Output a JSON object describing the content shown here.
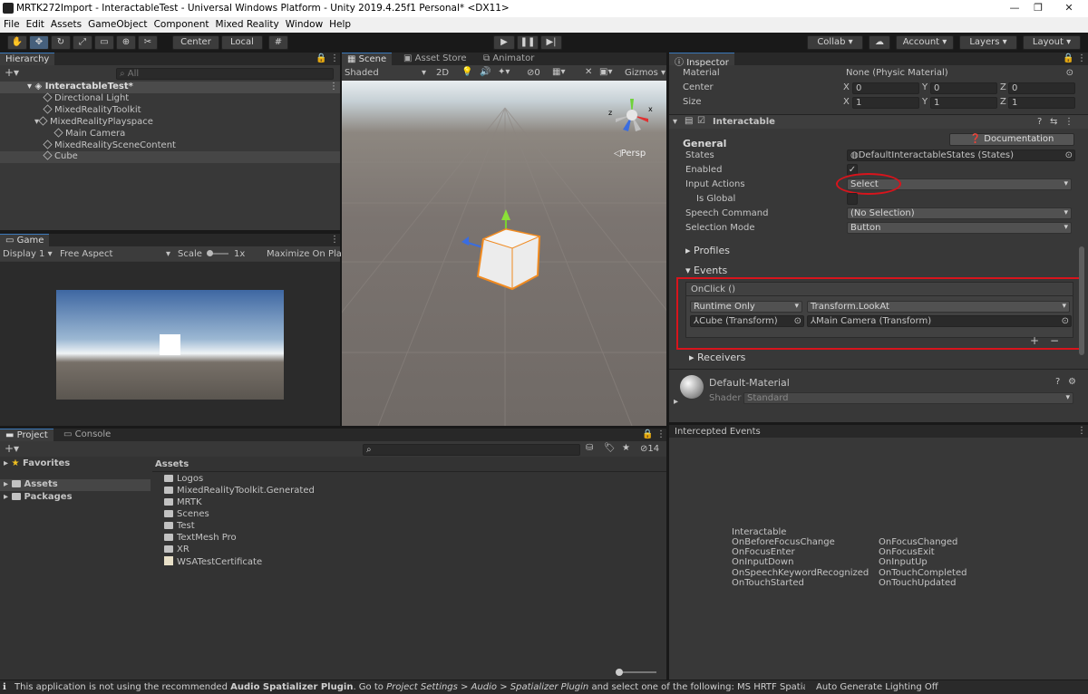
{
  "window": {
    "title": "MRTK272Import - InteractableTest - Universal Windows Platform - Unity 2019.4.25f1 Personal* <DX11>"
  },
  "menu": [
    "File",
    "Edit",
    "Assets",
    "GameObject",
    "Component",
    "Mixed Reality",
    "Window",
    "Help"
  ],
  "toolbar": {
    "center": "Center",
    "local": "Local",
    "collab": "Collab",
    "account": "Account",
    "layers": "Layers",
    "layout": "Layout"
  },
  "hierarchy": {
    "tab": "Hierarchy",
    "search_placeholder": "All",
    "scene": "InteractableTest*",
    "items": [
      {
        "label": "Directional Light"
      },
      {
        "label": "MixedRealityToolkit"
      },
      {
        "label": "MixedRealityPlayspace"
      },
      {
        "label": "Main Camera"
      },
      {
        "label": "MixedRealitySceneContent"
      },
      {
        "label": "Cube"
      }
    ]
  },
  "scene_view": {
    "tabs": [
      "Scene",
      "Asset Store",
      "Animator"
    ],
    "shading": "Shaded",
    "mode_2d": "2D",
    "hidden_count": "0",
    "gizmos": "Gizmos",
    "persp": "Persp"
  },
  "game_view": {
    "tab": "Game",
    "display": "Display 1",
    "aspect": "Free Aspect",
    "scale_label": "Scale",
    "scale_value": "1x",
    "maximize": "Maximize On Play"
  },
  "inspector": {
    "tab": "Inspector",
    "collider": {
      "material_label": "Material",
      "material_value": "None (Physic Material)",
      "center_label": "Center",
      "center": {
        "x": "0",
        "y": "0",
        "z": "0"
      },
      "size_label": "Size",
      "size": {
        "x": "1",
        "y": "1",
        "z": "1"
      }
    },
    "component": "Interactable",
    "general": "General",
    "documentation": "Documentation",
    "states_label": "States",
    "states_value": "DefaultInteractableStates (States)",
    "enabled_label": "Enabled",
    "input_actions_label": "Input Actions",
    "input_actions_value": "Select",
    "is_global_label": "Is Global",
    "speech_label": "Speech Command",
    "speech_value": "(No Selection)",
    "selection_mode_label": "Selection Mode",
    "selection_mode_value": "Button",
    "profiles": "Profiles",
    "events": "Events",
    "onclick": "OnClick ()",
    "runtime": "Runtime Only",
    "function": "Transform.LookAt",
    "target_object": "Cube (Transform)",
    "argument": "Main Camera (Transform)",
    "plus": "+",
    "minus": "−",
    "receivers": "Receivers",
    "material_name": "Default-Material",
    "shader_label": "Shader",
    "shader_value": "Standard"
  },
  "intercepted": {
    "title": "Intercepted Events",
    "heading": "Interactable",
    "left": [
      "OnBeforeFocusChange",
      "OnFocusEnter",
      "OnInputDown",
      "OnSpeechKeywordRecognized",
      "OnTouchStarted"
    ],
    "right": [
      "OnFocusChanged",
      "OnFocusExit",
      "OnInputUp",
      "OnTouchCompleted",
      "OnTouchUpdated"
    ]
  },
  "project": {
    "tabs": [
      "Project",
      "Console"
    ],
    "hidden_count": "14",
    "favorites": "Favorites",
    "assets_root": "Assets",
    "packages": "Packages",
    "breadcrumb": "Assets",
    "items": [
      "Logos",
      "MixedRealityToolkit.Generated",
      "MRTK",
      "Scenes",
      "Test",
      "TextMesh Pro",
      "XR",
      "WSATestCertificate"
    ]
  },
  "status": {
    "pre": "This application is not using the recommended ",
    "bold": "Audio Spatializer Plugin",
    "mid": ". Go to ",
    "path": "Project Settings > Audio > Spatializer Plugin",
    "post": " and select one of the following: MS HRTF Spatializer, Microsoft S",
    "lighting": "Auto Generate Lighting Off"
  },
  "colors": {
    "accent": "#3a79bb",
    "highlight": "#d8141c",
    "panel": "#383838"
  }
}
